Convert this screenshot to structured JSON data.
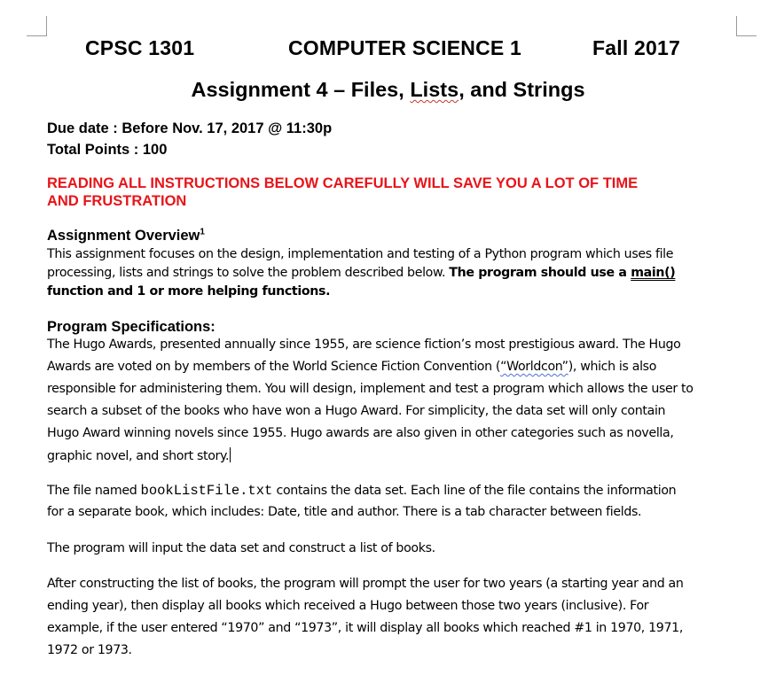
{
  "header": {
    "course": "CPSC 1301",
    "subject": "COMPUTER SCIENCE 1",
    "term": "Fall 2017"
  },
  "title": {
    "pre": "Assignment 4 – Files, ",
    "lists": "Lists",
    "post": ", and Strings"
  },
  "due_date": "Due date : Before Nov. 17, 2017 @ 11:30p",
  "total_points": "Total Points : 100",
  "warning": {
    "line1": "READING ALL INSTRUCTIONS BELOW CAREFULLY WILL SAVE YOU A LOT OF TIME",
    "line2": "AND FRUSTRATION"
  },
  "overview": {
    "heading": "Assignment Overview",
    "footnote": "1",
    "line1": "This assignment focuses on the design, implementation and testing of a Python program which uses file",
    "line2_plain": "processing, lists and strings to solve the problem described below. ",
    "line2_bold": "The program should use a ",
    "line2_main": "main()",
    "line3": "function and 1 or more helping functions."
  },
  "specs": {
    "heading": "Program Specifications:",
    "p1_l1": "The Hugo Awards, presented annually since 1955, are science fiction’s most prestigious award. The Hugo",
    "p1_l2_pre": "Awards are voted on by members of the World Science Fiction Convention (",
    "p1_l2_word": "“Worldcon”",
    "p1_l2_post": "), which is also",
    "p1_l3": "responsible for administering them. You will design, implement and test a program which allows the user to",
    "p1_l4": "search a subset of the books who have won a Hugo Award.  For simplicity, the data set will only contain",
    "p1_l5": "Hugo Award winning novels since 1955. Hugo awards are also given in other categories such as novella,",
    "p1_l6": "graphic novel, and short story.",
    "p2_l1_pre": "The file named ",
    "p2_l1_file": "bookListFile.txt",
    "p2_l1_post": " contains the data set.  Each line of the file contains the information",
    "p2_l2": "for a separate book, which includes:  Date, title and author.  There is a tab character between fields.",
    "p3_l1": "The program will input the data set and construct a list of books.",
    "p4_l1": "After constructing the list of books, the program will prompt the user for two years (a starting year and an",
    "p4_l2": "ending year), then display all books which received a Hugo between those two years (inclusive).  For",
    "p4_l3": "example, if the user entered “1970” and “1973”, it will display all books which reached #1 in 1970, 1971,",
    "p4_l4": "1972 or 1973."
  }
}
